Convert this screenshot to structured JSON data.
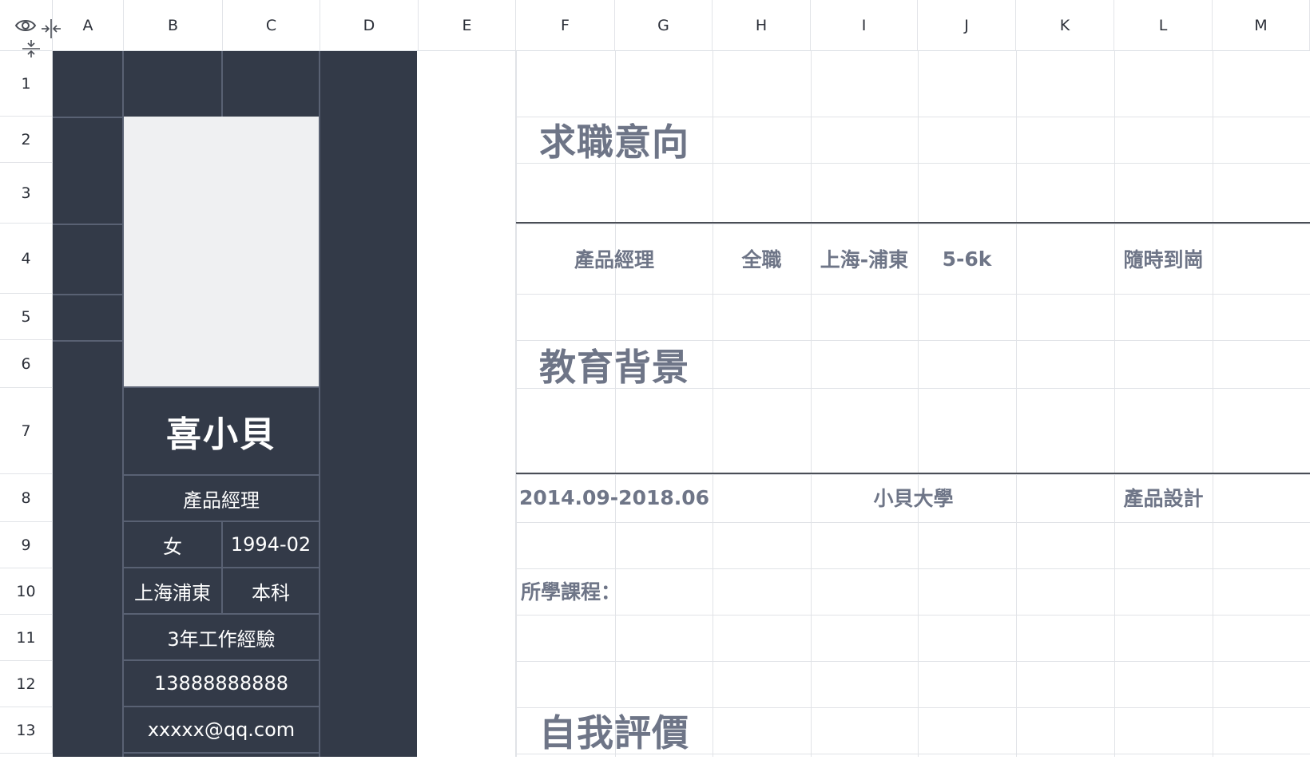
{
  "columns": [
    "A",
    "B",
    "C",
    "D",
    "E",
    "F",
    "G",
    "H",
    "I",
    "J",
    "K",
    "L",
    "M"
  ],
  "rows": [
    "1",
    "2",
    "3",
    "4",
    "5",
    "6",
    "7",
    "8",
    "9",
    "10",
    "11",
    "12",
    "13"
  ],
  "toolbar_icons": [
    "eye-icon",
    "collapse-columns-icon",
    "collapse-rows-icon"
  ],
  "colors": {
    "sidebar_dark": "#333a48",
    "photo_placeholder": "#eff0f2",
    "accent_text": "#6e7587",
    "grid": "#e1e3e7"
  },
  "profile": {
    "name": "喜小貝",
    "title": "產品經理",
    "gender": "女",
    "birth": "1994-02",
    "location": "上海浦東",
    "degree": "本科",
    "experience": "3年工作經驗",
    "phone": "13888888888",
    "email": "xxxxx@qq.com"
  },
  "sections": {
    "intent": "求職意向",
    "education": "教育背景",
    "self_eval": "自我評價"
  },
  "intent": {
    "position": "產品經理",
    "type": "全職",
    "city": "上海-浦東",
    "salary": "5-6k",
    "availability": "隨時到崗"
  },
  "education": {
    "period": "2014.09-2018.06",
    "school": "小貝大學",
    "major": "產品設計",
    "courses_label": "所學課程："
  }
}
